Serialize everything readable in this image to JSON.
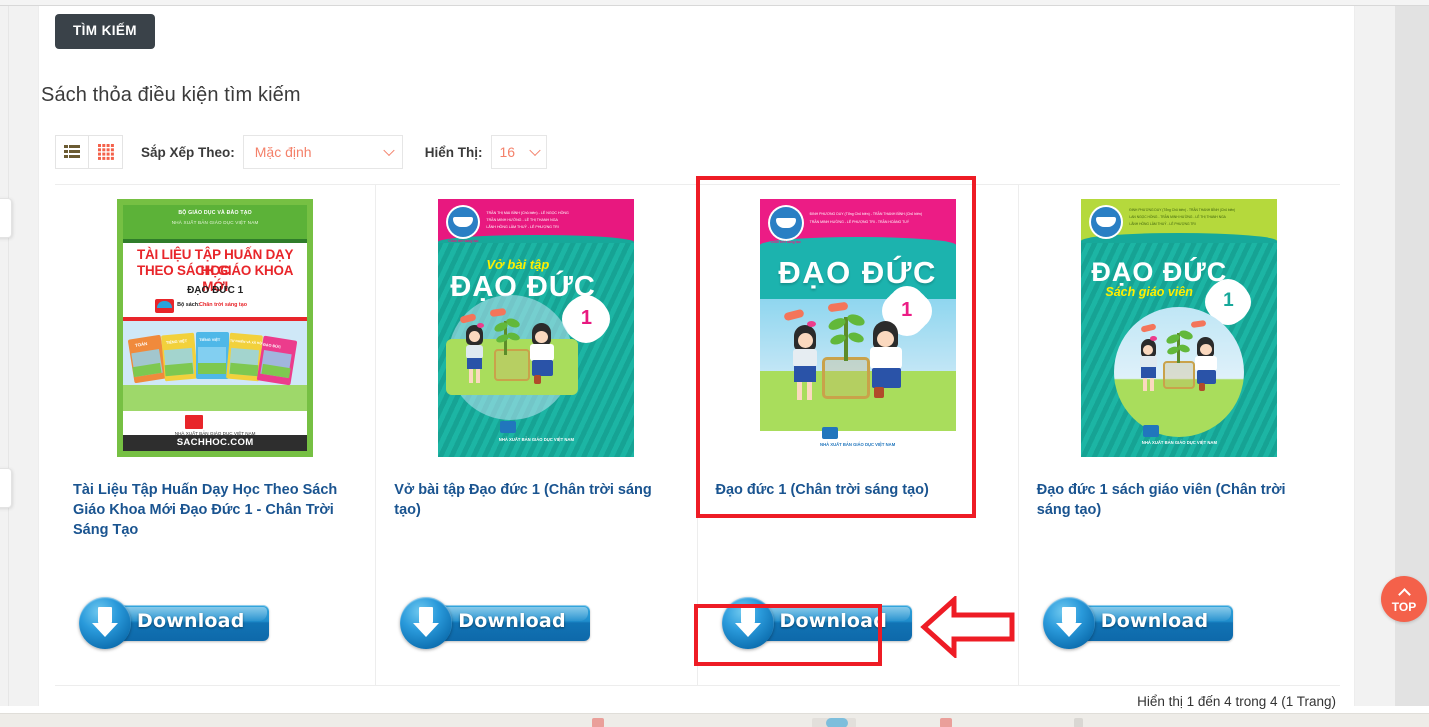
{
  "toolbar": {
    "search_button": "TÌM KIẾM"
  },
  "results": {
    "heading": "Sách thỏa điều kiện tìm kiếm",
    "count_text": "Hiển thị 1 đến 4 trong 4 (1 Trang)"
  },
  "controls": {
    "list_view_icon": "list-view-icon",
    "grid_view_icon": "grid-view-icon",
    "sort_label": "Sắp Xếp Theo:",
    "sort_value": "Mặc định",
    "sort_options": [
      "Mặc định"
    ],
    "limit_label": "Hiển Thị:",
    "limit_value": "16",
    "limit_options": [
      "16"
    ]
  },
  "products": [
    {
      "title": "Tài Liệu Tập Huấn Dạy Học Theo Sách Giáo Khoa Mới Đạo Đức 1 - Chân Trời Sáng Tạo",
      "download_label": "Download",
      "cover": {
        "publisher_line1": "BỘ GIÁO DỤC VÀ ĐÀO TẠO",
        "publisher_line2": "NHÀ XUẤT BẢN GIÁO DỤC VIỆT NAM",
        "title_line1": "TÀI LIỆU TẬP HUẤN DẠY HỌC",
        "title_line2": "THEO SÁCH GIÁO KHOA MỚI",
        "subject": "ĐẠO ĐỨC 1",
        "series_prefix": "Bộ sách:",
        "series_name": "Chân trời sáng tạo",
        "footer_publisher": "NHÀ XUẤT BẢN GIÁO DỤC VIỆT NAM",
        "site": "SACHHOC.COM",
        "mini_books": [
          "TOÁN",
          "TIẾNG VIỆT",
          "TIẾNG VIỆT",
          "TỰ NHIÊN VÀ XÃ HỘI",
          "ĐẠO ĐỨC"
        ]
      }
    },
    {
      "title": "Vở bài tập Đạo đức 1 (Chân trời sáng tạo)",
      "download_label": "Download",
      "cover": {
        "badge": "Chân trời sáng tạo",
        "authors_line1": "TRẦN THỊ MAI BÌNH (Chủ biên) - LÊ NGỌC HỒNG",
        "authors_line2": "TRẦN MINH HƯỜNG - LÊ THỊ THANH NGA",
        "authors_line3": "LÃNH HỒNG LÂM THUỶ - LÊ PHƯỢNG TRI",
        "kicker": "Vở bài tập",
        "title": "ĐẠO ĐỨC",
        "grade": "1",
        "publisher": "NHÀ XUẤT BẢN GIÁO DỤC VIỆT NAM"
      }
    },
    {
      "title": "Đạo đức 1 (Chân trời sáng tạo)",
      "download_label": "Download",
      "highlighted": true,
      "cover": {
        "badge": "Chân trời sáng tạo",
        "authors_line1": "ĐINH PHƯƠNG DUY (Tổng Chủ biên) - TRẦN THANH BÌNH (Chủ biên)",
        "authors_line2": "TRẦN MINH HƯỜNG - LÊ PHƯỢNG TRI - TRẦN HOÀNG TUÝ",
        "title": "ĐẠO ĐỨC",
        "grade": "1",
        "publisher": "NHÀ XUẤT BẢN GIÁO DỤC VIỆT NAM"
      }
    },
    {
      "title": "Đạo đức 1 sách giáo viên (Chân trời sáng tạo)",
      "download_label": "Download",
      "cover": {
        "badge": "Chân trời sáng tạo",
        "authors_line1": "ĐINH PHƯƠNG DUY (Tổng Chủ biên) - TRẦN THANH BÌNH (Chủ biên)",
        "authors_line2": "LAN NGỌC HỒNG - TRẦN MINH HƯỜNG - LÊ THỊ THANH NGA",
        "authors_line3": "LÃNH HỒNG LÂM THUỶ - LÊ PHƯỢNG TRI",
        "title": "ĐẠO ĐỨC",
        "subtitle": "Sách giáo viên",
        "grade": "1",
        "publisher": "NHÀ XUẤT BẢN GIÁO DỤC VIỆT NAM"
      }
    }
  ],
  "scroll_top_button": {
    "label": "TOP",
    "icon": "chevron-up-icon"
  },
  "annotations": {
    "highlight_color": "#ee1c25",
    "pointer_icon": "left-arrow-annotation"
  },
  "colors": {
    "accent_orange": "#f4816a",
    "link_blue": "#1a5490",
    "search_button_bg": "#3a4249",
    "top_button_bg": "#f4614a"
  }
}
